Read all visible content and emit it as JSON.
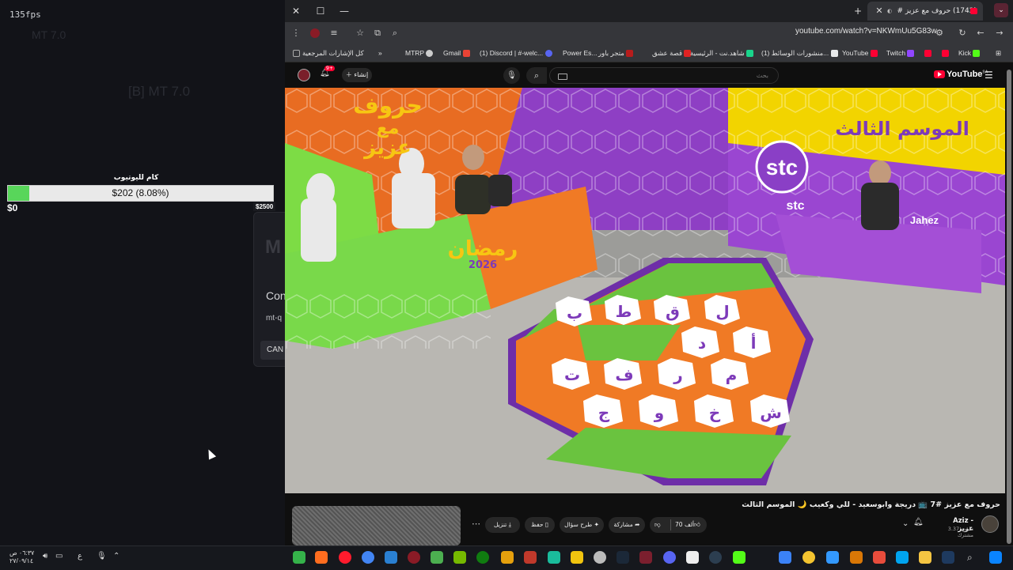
{
  "overlay": {
    "fps": "135fps",
    "ghost_title": "MT 7.0",
    "ghost_title2": "[B] MT 7.0",
    "goal_label": "كام لليوتيوب",
    "goal_amount": "$202 (8.08%)",
    "goal_progress": 0.0808,
    "goal_min": "$0",
    "goal_max": "$2500",
    "dialog_logo": "M",
    "dialog_title": "Con",
    "dialog_sub": "mt-q",
    "dialog_button": "CAN"
  },
  "browser": {
    "tab_title": "(1742) حروف مع عزيز #7 📺",
    "url": "youtube.com/watch?v=NKWmUu5G83w",
    "bookmarks": [
      {
        "label": "Kick",
        "color": "#53fc18"
      },
      {
        "label": "",
        "color": "#ff0033"
      },
      {
        "label": "",
        "color": "#9146ff"
      },
      {
        "label": "Twitch",
        "color": "#9146ff"
      },
      {
        "label": "YouTube",
        "color": "#ff0033"
      },
      {
        "label": "(1) منشورات الوسائط...",
        "color": "#e7e9ea"
      },
      {
        "label": "شاهد.نت - الرئيسية",
        "color": "#19d48b"
      },
      {
        "label": "قصة عشق",
        "color": "#e02323"
      },
      {
        "label": "متجر باور",
        "color": "#b71c1c"
      },
      {
        "label": "Power Es...",
        "color": "#444"
      },
      {
        "label": "(1) Discord | #-welc...",
        "color": "#5865f2"
      },
      {
        "label": "Gmail",
        "color": "#ea4335"
      },
      {
        "label": "MTRP",
        "color": "#cccccc"
      },
      {
        "label": "»",
        "color": ""
      },
      {
        "label": "كل الإشارات المرجعية",
        "color": "#aaaaaa"
      }
    ]
  },
  "youtube": {
    "logo": "YouTube",
    "logo_region": "SA",
    "search_placeholder": "بحث",
    "create_label": "إنشاء",
    "notif_count": "9+",
    "video_title": "حروف مع عزيز #7 📺 دريجة وابوسعيد - للي وكعيب 🌙 الموسم الثالث",
    "channel_name": "Aziz - عزيز",
    "channel_subs": "3.37 مليون مشترك",
    "actions": {
      "like": "70 ألف",
      "share": "مشاركة",
      "ask": "طرح سؤال",
      "save": "حفظ",
      "download": "تنزيل"
    }
  },
  "scene": {
    "board_letters": [
      "ل",
      "ق",
      "ط",
      "ب",
      "أ",
      "د",
      "م",
      "ر",
      "ف",
      "ت",
      "ش",
      "خ",
      "و",
      "ج"
    ],
    "set_logo_line1": "حروف",
    "set_logo_line2": "مع",
    "set_logo_line3": "عزيز",
    "season_text": "الموسم الثالث",
    "ramadan_text": "رمضان",
    "ramadan_year": "2026",
    "sponsor": "stc",
    "sponsor2": "Jahez"
  },
  "taskbar": {
    "time": "٠٦:٣٧ ص",
    "date": "٢٧/٠٩/١٤",
    "lang": "ع"
  }
}
